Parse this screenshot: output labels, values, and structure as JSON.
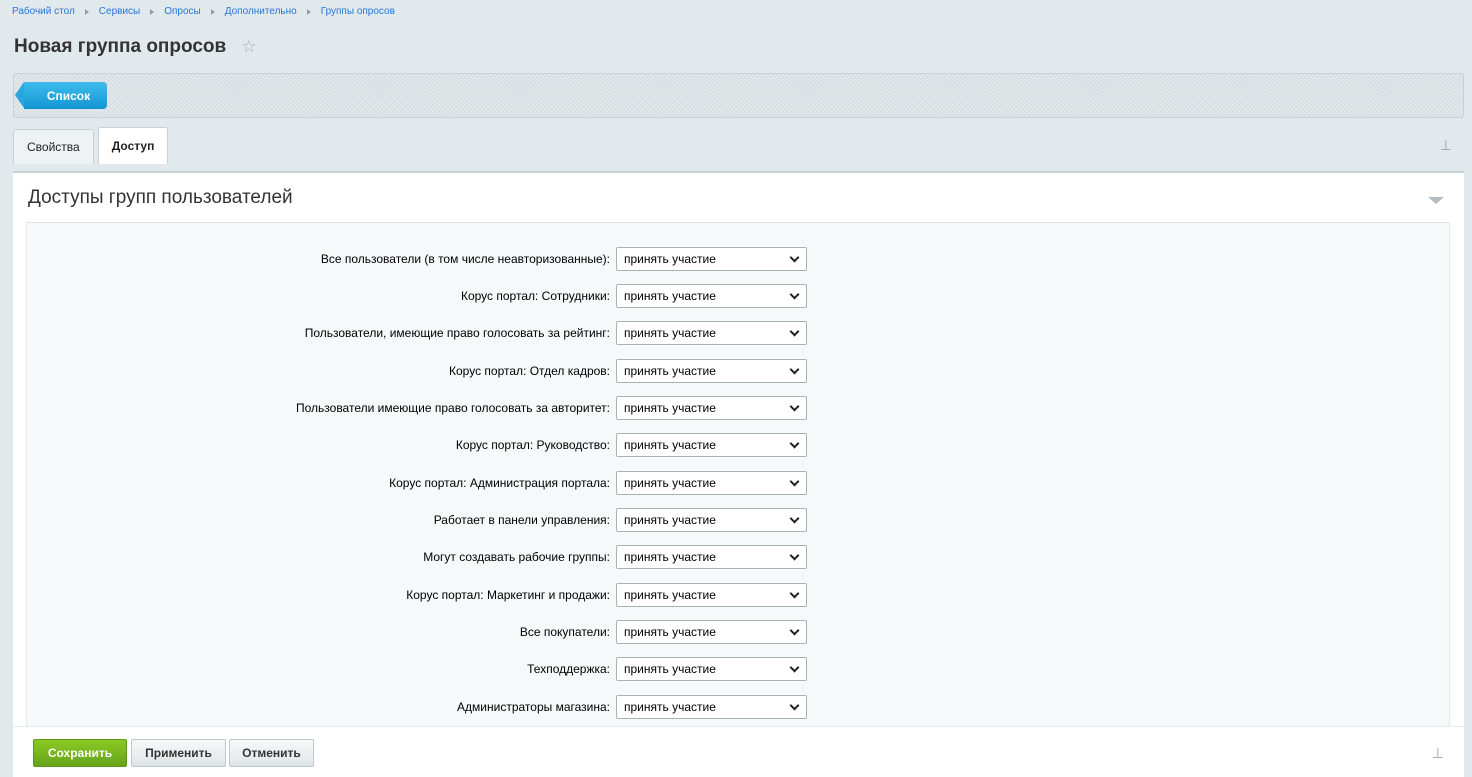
{
  "breadcrumb": [
    "Рабочий стол",
    "Сервисы",
    "Опросы",
    "Дополнительно",
    "Группы опросов"
  ],
  "page_title": "Новая группа опросов",
  "toolbar": {
    "list_label": "Список"
  },
  "tabs": [
    {
      "label": "Свойства",
      "active": false
    },
    {
      "label": "Доступ",
      "active": true
    }
  ],
  "panel": {
    "title": "Доступы групп пользователей",
    "rows": [
      {
        "label": "Все пользователи (в том числе неавторизованные):",
        "value": "принять участие"
      },
      {
        "label": "Корус портал: Сотрудники:",
        "value": "принять участие"
      },
      {
        "label": "Пользователи, имеющие право голосовать за рейтинг:",
        "value": "принять участие"
      },
      {
        "label": "Корус портал: Отдел кадров:",
        "value": "принять участие"
      },
      {
        "label": "Пользователи имеющие право голосовать за авторитет:",
        "value": "принять участие"
      },
      {
        "label": "Корус портал: Руководство:",
        "value": "принять участие"
      },
      {
        "label": "Корус портал: Администрация портала:",
        "value": "принять участие"
      },
      {
        "label": "Работает в панели управления:",
        "value": "принять участие"
      },
      {
        "label": "Могут создавать рабочие группы:",
        "value": "принять участие"
      },
      {
        "label": "Корус портал: Маркетинг и продажи:",
        "value": "принять участие"
      },
      {
        "label": "Все покупатели:",
        "value": "принять участие"
      },
      {
        "label": "Техподдержка:",
        "value": "принять участие"
      },
      {
        "label": "Администраторы магазина:",
        "value": "принять участие"
      }
    ]
  },
  "footer": {
    "save_label": "Сохранить",
    "apply_label": "Применить",
    "cancel_label": "Отменить"
  },
  "colors": {
    "accent_blue": "#1296d3",
    "save_green": "#66a31a",
    "link": "#2675d7"
  }
}
